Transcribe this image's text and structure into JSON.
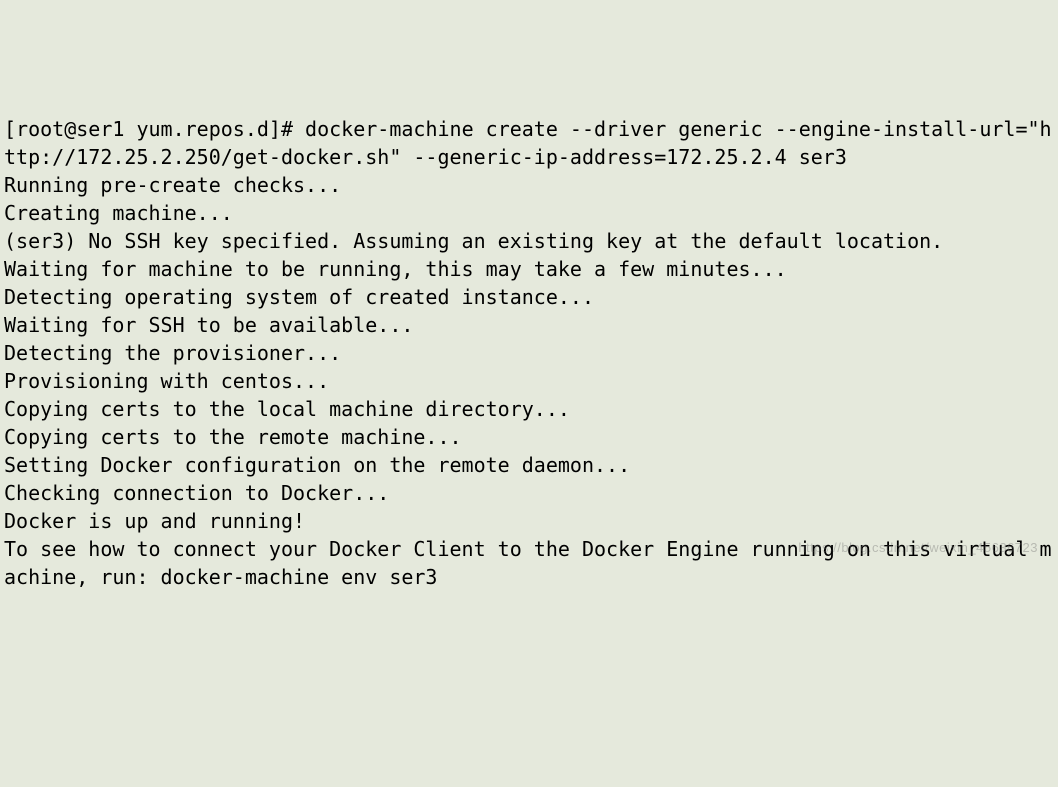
{
  "terminal": {
    "prompt": "[root@ser1 yum.repos.d]# ",
    "command": "docker-machine create --driver generic --engine-install-url=\"http://172.25.2.250/get-docker.sh\" --generic-ip-address=172.25.2.4 ser3",
    "lines": [
      "Running pre-create checks...",
      "Creating machine...",
      "(ser3) No SSH key specified. Assuming an existing key at the default location.",
      "Waiting for machine to be running, this may take a few minutes...",
      "Detecting operating system of created instance...",
      "Waiting for SSH to be available...",
      "Detecting the provisioner...",
      "Provisioning with centos...",
      "Copying certs to the local machine directory...",
      "Copying certs to the remote machine...",
      "Setting Docker configuration on the remote daemon...",
      "Checking connection to Docker...",
      "Docker is up and running!",
      "To see how to connect your Docker Client to the Docker Engine running on this virtual machine, run: docker-machine env ser3"
    ]
  },
  "watermark": "https://blog.csdn.net/weixin_45636723"
}
